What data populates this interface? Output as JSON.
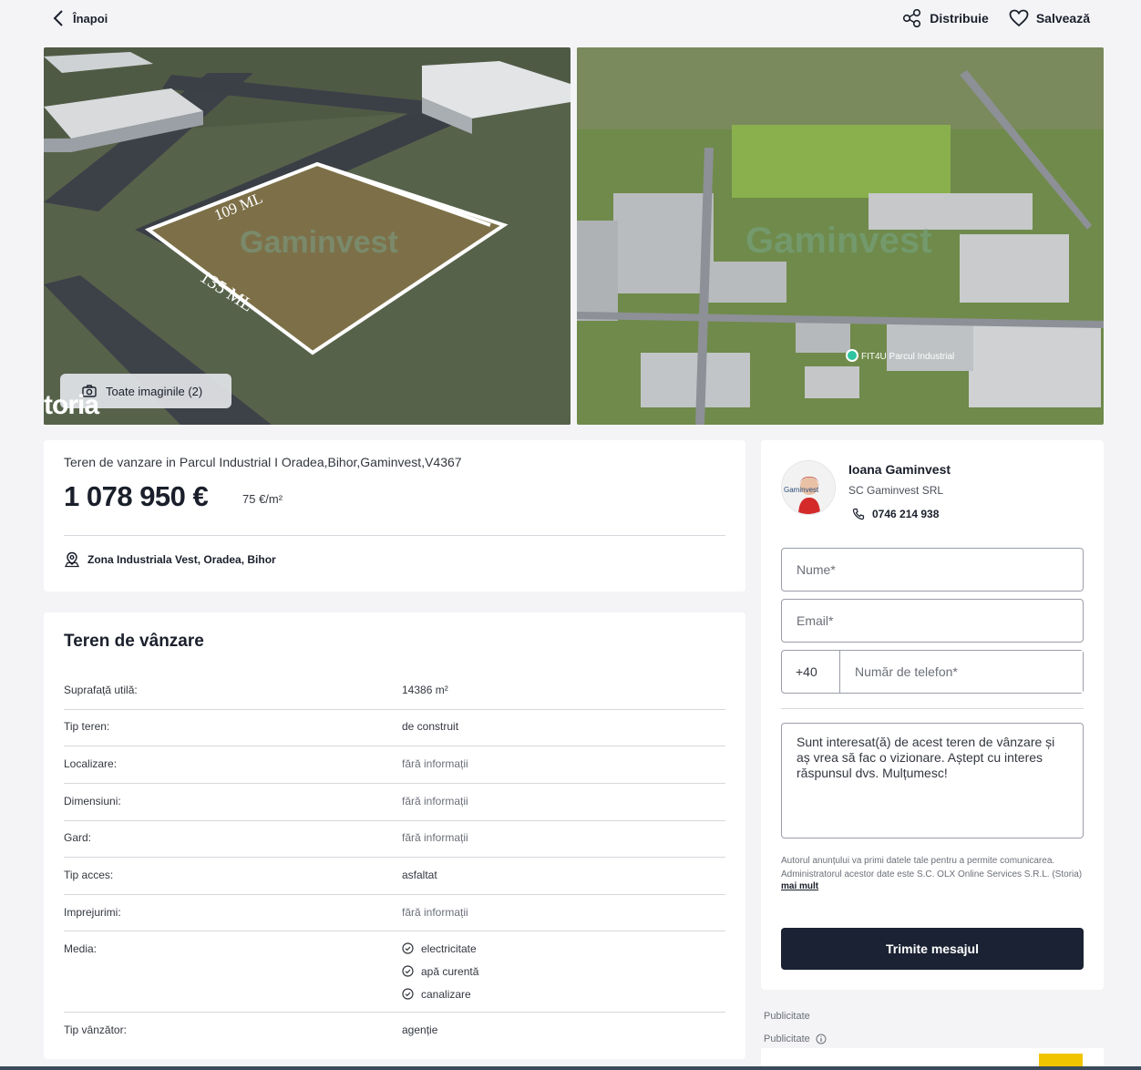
{
  "topbar": {
    "back_label": "Înapoi",
    "share_label": "Distribuie",
    "save_label": "Salvează"
  },
  "gallery": {
    "all_images_label": "Toate imaginile (2)",
    "brand_mark": "toria",
    "photo1_labels": [
      "109 ML",
      "135 ML"
    ],
    "photo1_watermark": "Gaminvest",
    "photo2_watermark": "Gaminvest",
    "photo2_pin_label": "FIT4U Parcul Industrial"
  },
  "listing": {
    "title": "Teren de vanzare in Parcul Industrial I Oradea,Bihor,Gaminvest,V4367",
    "price": "1 078 950 €",
    "price_per_sqm": "75 €/m²",
    "location": "Zona Industriala Vest, Oradea, Bihor"
  },
  "details": {
    "heading": "Teren de vânzare",
    "rows": [
      {
        "key": "Suprafață utilă:",
        "value": "14386 m²"
      },
      {
        "key": "Tip teren:",
        "value": "de construit"
      },
      {
        "key": "Localizare:",
        "value": "fără informații"
      },
      {
        "key": "Dimensiuni:",
        "value": "fără informații"
      },
      {
        "key": "Gard:",
        "value": "fără informații"
      },
      {
        "key": "Tip acces:",
        "value": "asfaltat"
      },
      {
        "key": "Imprejurimi:",
        "value": "fără informații"
      },
      {
        "key": "Media:",
        "values": [
          "electricitate",
          "apă curentă",
          "canalizare"
        ]
      },
      {
        "key": "Tip vânzător:",
        "value": "agenție"
      }
    ]
  },
  "contact": {
    "agent_name": "Ioana Gaminvest",
    "agency": "SC Gaminvest SRL",
    "phone": "0746 214 938",
    "avatar_text": "Gaminvest",
    "name_placeholder": "Nume*",
    "email_placeholder": "Email*",
    "phone_prefix": "+40",
    "phone_placeholder": "Număr de telefon*",
    "message": "Sunt interesat(ă) de acest teren de vânzare și aș vrea să fac o vizionare. Aștept cu interes răspunsul dvs. Mulțumesc!",
    "disclaimer_1": "Autorul anunțului va primi datele tale pentru a permite comunicarea.",
    "disclaimer_2": "Administratorul acestor date este S.C. OLX Online Services S.R.L. (Storia)",
    "more_link": "mai mult",
    "send_label": "Trimite mesajul"
  },
  "ads": {
    "label_1": "Publicitate",
    "label_2": "Publicitate"
  },
  "colors": {
    "primary_dark": "#1a2233",
    "page_bg": "#f4f4f6",
    "card_bg": "#ffffff",
    "border": "#d6d8dd",
    "ad_yellow": "#f1c400"
  }
}
